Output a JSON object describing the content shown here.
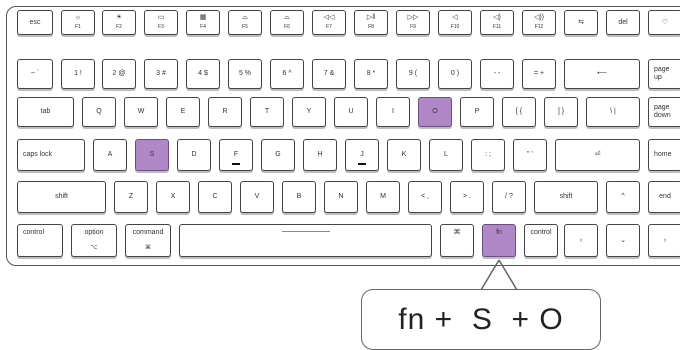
{
  "keyboard": {
    "highlight_color": "#b188c7",
    "rows": {
      "fn": {
        "esc": "esc",
        "f1": {
          "icon": "☼",
          "label": "F1"
        },
        "f2": {
          "icon": "☀",
          "label": "F2"
        },
        "f3": {
          "icon": "▭",
          "label": "F3"
        },
        "f4": {
          "icon": "▦",
          "label": "F4"
        },
        "f5": {
          "icon": "⌓",
          "label": "F5"
        },
        "f6": {
          "icon": "⌓",
          "label": "F6"
        },
        "f7": {
          "icon": "◁◁",
          "label": "F7"
        },
        "f8": {
          "icon": "▷‖",
          "label": "F8"
        },
        "f9": {
          "icon": "▷▷",
          "label": "F9"
        },
        "f10": {
          "icon": "◁",
          "label": "F10"
        },
        "f11": {
          "icon": "◁)",
          "label": "F11"
        },
        "f12": {
          "icon": "◁))",
          "label": "F12"
        },
        "f13": {
          "icon": "⇆",
          "label": ""
        },
        "del": "del",
        "light": "♡"
      },
      "number": {
        "tilde": "~ `",
        "n1": "1 !",
        "n2": "2 @",
        "n3": "3 #",
        "n4": "4 $",
        "n5": "5 %",
        "n6": "6 ^",
        "n7": "7 &",
        "n8": "8 *",
        "n9": "9 (",
        "n0": "0 )",
        "minus": "- -",
        "equals": "= +",
        "backspace": "⟵",
        "pageup": "page up",
        "corner_1": "",
        "corner_2": "",
        "corner_3": "",
        "corner_4": ""
      },
      "tab": {
        "tab": "tab",
        "q": "Q",
        "w": "W",
        "e": "E",
        "r": "R",
        "t": "T",
        "y": "Y",
        "u": "U",
        "i": "I",
        "o": "O",
        "p": "P",
        "lbracket": "[ {",
        "rbracket": "] }",
        "backslash": "\\ |",
        "pagedown": "page down"
      },
      "caps": {
        "capslock": "caps lock",
        "a": "A",
        "s": "S",
        "d": "D",
        "f": "F",
        "g": "G",
        "h": "H",
        "j": "J",
        "k": "K",
        "l": "L",
        "semicolon": ": ;",
        "quote": "\" '",
        "enter": "⏎",
        "home": "home"
      },
      "shift": {
        "lshift": "shift",
        "z": "Z",
        "x": "X",
        "c": "C",
        "v": "V",
        "b": "B",
        "n": "N",
        "m": "M",
        "comma": "< ,",
        "period": "> .",
        "slash": "/ ?",
        "rshift": "shift",
        "up": "^",
        "end": "end"
      },
      "bottom": {
        "lcontrol": "control",
        "option": {
          "label": "option",
          "symbol": "⌥"
        },
        "command": {
          "label": "command",
          "symbol": "⌘"
        },
        "rcommand": "⌘",
        "fn": "fn",
        "rcontrol": "control",
        "left": "‹",
        "down": "⌄",
        "right": "›"
      }
    }
  },
  "combo": {
    "text": "fn +  S  + O"
  }
}
